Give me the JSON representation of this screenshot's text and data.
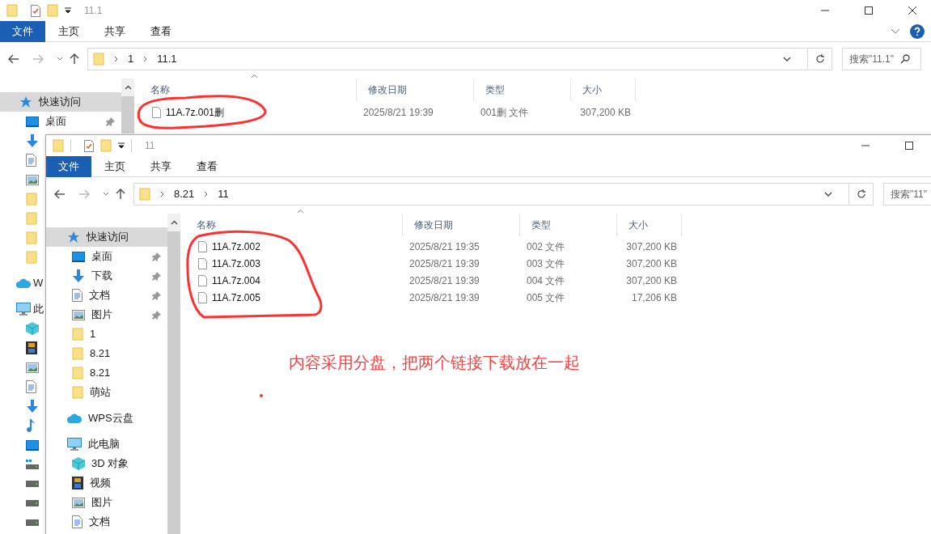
{
  "back_window": {
    "title": "11.1",
    "ribbon_tabs": [
      {
        "label": "文件",
        "selected": true
      },
      {
        "label": "主页",
        "selected": false
      },
      {
        "label": "共享",
        "selected": false
      },
      {
        "label": "查看",
        "selected": false
      }
    ],
    "path": [
      "1",
      "11.1"
    ],
    "search": {
      "placeholder": "搜索\"11.1\""
    },
    "columns": [
      "名称",
      "修改日期",
      "类型",
      "大小"
    ],
    "sidebar": [
      {
        "kind": "star",
        "label": "快速访问",
        "selected": true,
        "children": [
          {
            "kind": "desktop",
            "label": "桌面",
            "pinned": true,
            "selected": false
          },
          {
            "kind": "download",
            "selected": false
          },
          {
            "kind": "document",
            "selected": false
          },
          {
            "kind": "picture",
            "selected": false
          },
          {
            "kind": "folder",
            "selected": false
          },
          {
            "kind": "folder",
            "selected": false
          },
          {
            "kind": "folder",
            "selected": false
          },
          {
            "kind": "folder",
            "selected": false
          }
        ]
      },
      {
        "kind": "cloud",
        "label": "W",
        "selected": false
      },
      {
        "kind": "pc",
        "label": "此",
        "selected": false,
        "children": [
          {
            "kind": "cube",
            "selected": false
          },
          {
            "kind": "video",
            "selected": false
          },
          {
            "kind": "picture",
            "selected": false
          },
          {
            "kind": "document",
            "selected": false
          },
          {
            "kind": "download",
            "selected": false
          },
          {
            "kind": "music",
            "selected": false
          },
          {
            "kind": "desktop",
            "selected": false
          },
          {
            "kind": "windrive",
            "selected": false
          },
          {
            "kind": "drive",
            "selected": false
          },
          {
            "kind": "drive",
            "selected": false
          },
          {
            "kind": "drive",
            "selected": false
          }
        ]
      }
    ],
    "rows": [
      {
        "name": "11A.7z.001删",
        "date": "2025/8/21 19:39",
        "type": "001删 文件",
        "size": "307,200 KB"
      }
    ]
  },
  "front_window": {
    "title": "11",
    "ribbon_tabs": [
      {
        "label": "文件",
        "selected": true
      },
      {
        "label": "主页",
        "selected": false
      },
      {
        "label": "共享",
        "selected": false
      },
      {
        "label": "查看",
        "selected": false
      }
    ],
    "path": [
      "8.21",
      "11"
    ],
    "search": {
      "placeholder": "搜索\"11\""
    },
    "columns": [
      "名称",
      "修改日期",
      "类型",
      "大小"
    ],
    "sidebar": [
      {
        "kind": "star",
        "label": "快速访问",
        "selected": true,
        "children": [
          {
            "kind": "desktop",
            "label": "桌面",
            "pinned": true,
            "selected": false
          },
          {
            "kind": "download",
            "label": "下载",
            "pinned": true,
            "selected": false
          },
          {
            "kind": "document",
            "label": "文档",
            "pinned": true,
            "selected": false
          },
          {
            "kind": "picture",
            "label": "图片",
            "pinned": true,
            "selected": false
          },
          {
            "kind": "folder",
            "label": "1",
            "selected": false
          },
          {
            "kind": "folder",
            "label": "8.21",
            "selected": false
          },
          {
            "kind": "folder",
            "label": "8.21",
            "selected": false
          },
          {
            "kind": "folder",
            "label": "萌站",
            "selected": false
          }
        ]
      },
      {
        "kind": "cloud",
        "label": "WPS云盘",
        "selected": false
      },
      {
        "kind": "pc",
        "label": "此电脑",
        "selected": false,
        "children": [
          {
            "kind": "cube",
            "label": "3D 对象",
            "selected": false
          },
          {
            "kind": "video",
            "label": "视频",
            "selected": false
          },
          {
            "kind": "picture",
            "label": "图片",
            "selected": false
          },
          {
            "kind": "document",
            "label": "文档",
            "selected": false
          }
        ]
      }
    ],
    "rows": [
      {
        "name": "11A.7z.002",
        "date": "2025/8/21 19:35",
        "type": "002 文件",
        "size": "307,200 KB"
      },
      {
        "name": "11A.7z.003",
        "date": "2025/8/21 19:39",
        "type": "003 文件",
        "size": "307,200 KB"
      },
      {
        "name": "11A.7z.004",
        "date": "2025/8/21 19:39",
        "type": "004 文件",
        "size": "307,200 KB"
      },
      {
        "name": "11A.7z.005",
        "date": "2025/8/21 19:39",
        "type": "005 文件",
        "size": "17,206 KB"
      }
    ]
  },
  "annotation": {
    "note": "内容采用分盘，把两个链接下载放在一起"
  }
}
